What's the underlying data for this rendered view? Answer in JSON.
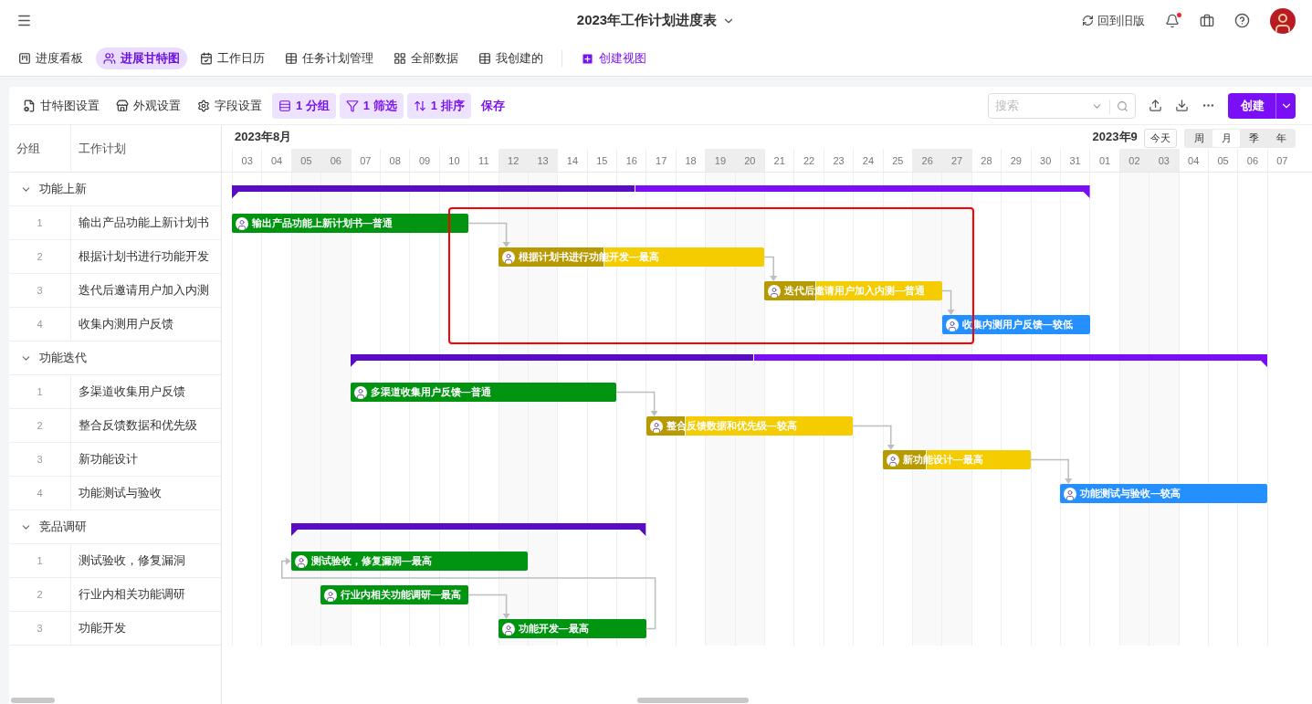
{
  "header": {
    "title": "2023年工作计划进度表",
    "old_version": "回到旧版",
    "has_notification": true
  },
  "views": [
    {
      "label": "进度看板",
      "selected": false
    },
    {
      "label": "进展甘特图",
      "selected": true
    },
    {
      "label": "工作日历",
      "selected": false
    },
    {
      "label": "任务计划管理",
      "selected": false
    },
    {
      "label": "全部数据",
      "selected": false
    },
    {
      "label": "我创建的",
      "selected": false
    }
  ],
  "create_view": "创建视图",
  "toolbar": {
    "items": [
      {
        "label": "甘特图设置",
        "kind": "plain"
      },
      {
        "label": "外观设置",
        "kind": "plain"
      },
      {
        "label": "字段设置",
        "kind": "plain"
      },
      {
        "label": "1 分组",
        "kind": "active"
      },
      {
        "label": "1 筛选",
        "kind": "active"
      },
      {
        "label": "1 排序",
        "kind": "active"
      },
      {
        "label": "保存",
        "kind": "link"
      }
    ],
    "search_placeholder": "搜索",
    "create": "创建"
  },
  "table": {
    "columns": [
      "分组",
      "工作计划"
    ]
  },
  "timeline": {
    "months": [
      {
        "label": "2023年8月",
        "days": [
          {
            "label": "03",
            "weekend": false
          },
          {
            "label": "04",
            "weekend": false
          },
          {
            "label": "05",
            "weekend": true
          },
          {
            "label": "06",
            "weekend": true
          },
          {
            "label": "07",
            "weekend": false
          },
          {
            "label": "08",
            "weekend": false
          },
          {
            "label": "09",
            "weekend": false
          },
          {
            "label": "10",
            "weekend": false
          },
          {
            "label": "11",
            "weekend": false
          },
          {
            "label": "12",
            "weekend": true
          },
          {
            "label": "13",
            "weekend": true
          },
          {
            "label": "14",
            "weekend": false
          },
          {
            "label": "15",
            "weekend": false
          },
          {
            "label": "16",
            "weekend": false
          },
          {
            "label": "17",
            "weekend": false
          },
          {
            "label": "18",
            "weekend": false
          },
          {
            "label": "19",
            "weekend": true
          },
          {
            "label": "20",
            "weekend": true
          },
          {
            "label": "21",
            "weekend": false
          },
          {
            "label": "22",
            "weekend": false
          },
          {
            "label": "23",
            "weekend": false
          },
          {
            "label": "24",
            "weekend": false
          },
          {
            "label": "25",
            "weekend": false
          },
          {
            "label": "26",
            "weekend": true
          },
          {
            "label": "27",
            "weekend": true
          },
          {
            "label": "28",
            "weekend": false
          },
          {
            "label": "29",
            "weekend": false
          },
          {
            "label": "30",
            "weekend": false
          },
          {
            "label": "31",
            "weekend": false
          }
        ]
      },
      {
        "label": "2023年9",
        "days": [
          {
            "label": "01",
            "weekend": false
          },
          {
            "label": "02",
            "weekend": true
          },
          {
            "label": "03",
            "weekend": true
          },
          {
            "label": "04",
            "weekend": false
          },
          {
            "label": "05",
            "weekend": false
          },
          {
            "label": "06",
            "weekend": false
          },
          {
            "label": "07",
            "weekend": false
          }
        ]
      }
    ],
    "today": "今天",
    "scales": [
      {
        "label": "周",
        "selected": false
      },
      {
        "label": "月",
        "selected": true
      },
      {
        "label": "季",
        "selected": false
      },
      {
        "label": "年",
        "selected": false
      }
    ],
    "annotation": {
      "kind": "rectangle"
    }
  },
  "groups": [
    {
      "name": "功能上新",
      "expanded": true,
      "level": 0.47,
      "tasks": [
        {
          "index": "1",
          "name": "输出产品功能上新计划书",
          "bar_label": "输出产品功能上新计划书—普通",
          "color": "#009411",
          "kind": "first"
        },
        {
          "index": "2",
          "name": "根据计划书进行功能开发",
          "bar_label": "根据计划书进行功能开发—最高",
          "color": "#f5cc00",
          "level": 0.4,
          "kind": "linked"
        },
        {
          "index": "3",
          "name": "迭代后邀请用户加入内测",
          "bar_label": "迭代后邀请用户加入内测—普通",
          "color": "#f5cc00",
          "level": 0.29,
          "kind": "linked"
        },
        {
          "index": "4",
          "name": "收集内测用户反馈",
          "bar_label": "收集内测用户反馈—较低",
          "color": "#2490ff",
          "kind": "linked"
        }
      ]
    },
    {
      "name": "功能迭代",
      "expanded": true,
      "level": 0.44,
      "tasks": [
        {
          "index": "1",
          "name": "多渠道收集用户反馈",
          "bar_label": "多渠道收集用户反馈—普通",
          "color": "#009411",
          "kind": "first"
        },
        {
          "index": "2",
          "name": "整合反馈数据和优先级",
          "bar_label": "整合反馈数据和优先级—较高",
          "color": "#f5cc00",
          "level": 0.19,
          "kind": "linked"
        },
        {
          "index": "3",
          "name": "新功能设计",
          "bar_label": "新功能设计—最高",
          "color": "#f5cc00",
          "level": 0.3,
          "kind": "linked"
        },
        {
          "index": "4",
          "name": "功能测试与验收",
          "bar_label": "功能测试与验收—较高",
          "color": "#2490ff",
          "kind": "linked"
        }
      ]
    },
    {
      "name": "竞品调研",
      "expanded": true,
      "level": 1,
      "tasks": [
        {
          "index": "1",
          "name": "测试验收，修复漏洞",
          "bar_label": "测试验收，修复漏洞—最高",
          "color": "#009411",
          "kind": "loop"
        },
        {
          "index": "2",
          "name": "行业内相关功能调研",
          "bar_label": "行业内相关功能调研—最高",
          "color": "#009411",
          "kind": "first"
        },
        {
          "index": "3",
          "name": "功能开发",
          "bar_label": "功能开发—最高",
          "color": "#009411",
          "kind": "linked"
        }
      ]
    }
  ]
}
